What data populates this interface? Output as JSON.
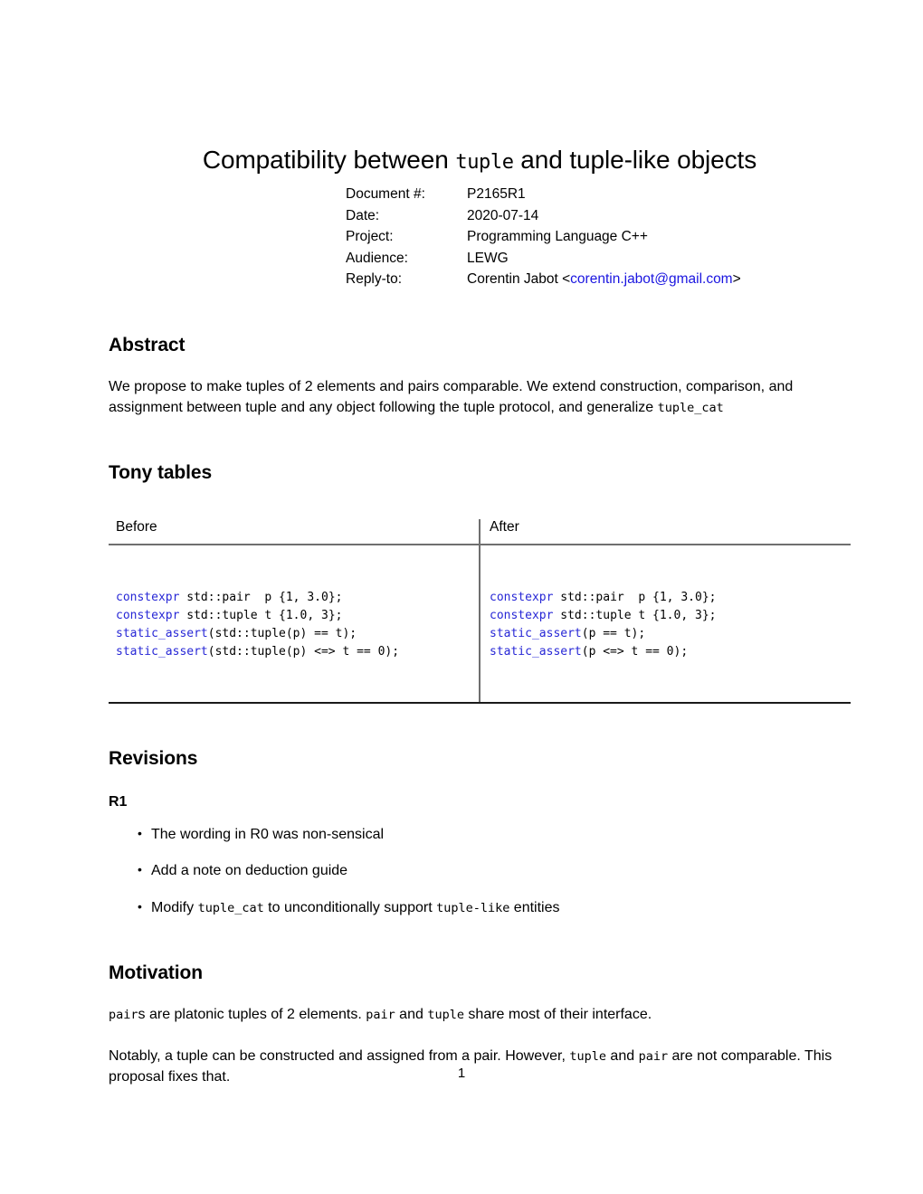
{
  "document": {
    "title_part1": "Compatibility between ",
    "title_mono": "tuple",
    "title_part2": " and tuple-like objects",
    "page_number": "1"
  },
  "metadata": {
    "rows": [
      {
        "label": "Document #:",
        "value": "P2165R1"
      },
      {
        "label": "Date:",
        "value": "2020-07-14"
      },
      {
        "label": "Project:",
        "value": "Programming Language C++"
      },
      {
        "label": "Audience:",
        "value": "LEWG"
      }
    ],
    "reply_to": {
      "label": "Reply-to:",
      "name": "Corentin Jabot <",
      "email": "corentin.jabot@gmail.com",
      "close": ">"
    }
  },
  "abstract": {
    "heading": "Abstract",
    "text_part1": "We propose to make tuples of 2 elements and pairs comparable. We extend construction, comparison, and assignment between tuple and any object following the tuple protocol, and generalize ",
    "text_mono": "tuple_cat"
  },
  "tony_tables": {
    "heading": "Tony tables",
    "columns": [
      "Before",
      "After"
    ],
    "before_code": [
      {
        "keyword": "constexpr",
        "rest": " std::pair  p {1, 3.0};"
      },
      {
        "keyword": "constexpr",
        "rest": " std::tuple t {1.0, 3};"
      },
      {
        "keyword": "static_assert",
        "rest": "(std::tuple(p) == t);"
      },
      {
        "keyword": "static_assert",
        "rest": "(std::tuple(p) <=> t == 0);"
      }
    ],
    "after_code": [
      {
        "keyword": "constexpr",
        "rest": " std::pair  p {1, 3.0};"
      },
      {
        "keyword": "constexpr",
        "rest": " std::tuple t {1.0, 3};"
      },
      {
        "keyword": "static_assert",
        "rest": "(p == t);"
      },
      {
        "keyword": "static_assert",
        "rest": "(p <=> t == 0);"
      }
    ]
  },
  "revisions": {
    "heading": "Revisions",
    "subheading": "R1",
    "items": [
      {
        "text": "The wording in R0 was non-sensical"
      },
      {
        "text": "Add a note on deduction guide"
      },
      {
        "prefix": "Modify ",
        "mono1": "tuple_cat",
        "middle": " to unconditionally support ",
        "mono2": "tuple-like",
        "suffix": " entities"
      }
    ]
  },
  "motivation": {
    "heading": "Motivation",
    "p1": {
      "mono1": "pair",
      "t1": "s are platonic tuples of 2 elements. ",
      "mono2": "pair",
      "t2": " and ",
      "mono3": "tuple",
      "t3": " share most of their interface."
    },
    "p2": {
      "t1": "Notably, a tuple can be constructed and assigned from a pair. However, ",
      "mono1": "tuple",
      "t2": " and ",
      "mono2": "pair",
      "t3": " are not comparable. This proposal fixes that."
    }
  },
  "colors": {
    "link": "#1a15e0",
    "code_keyword": "#2727d6",
    "rule_light": "#6f6f6f",
    "rule_dark": "#1a1a1a"
  }
}
